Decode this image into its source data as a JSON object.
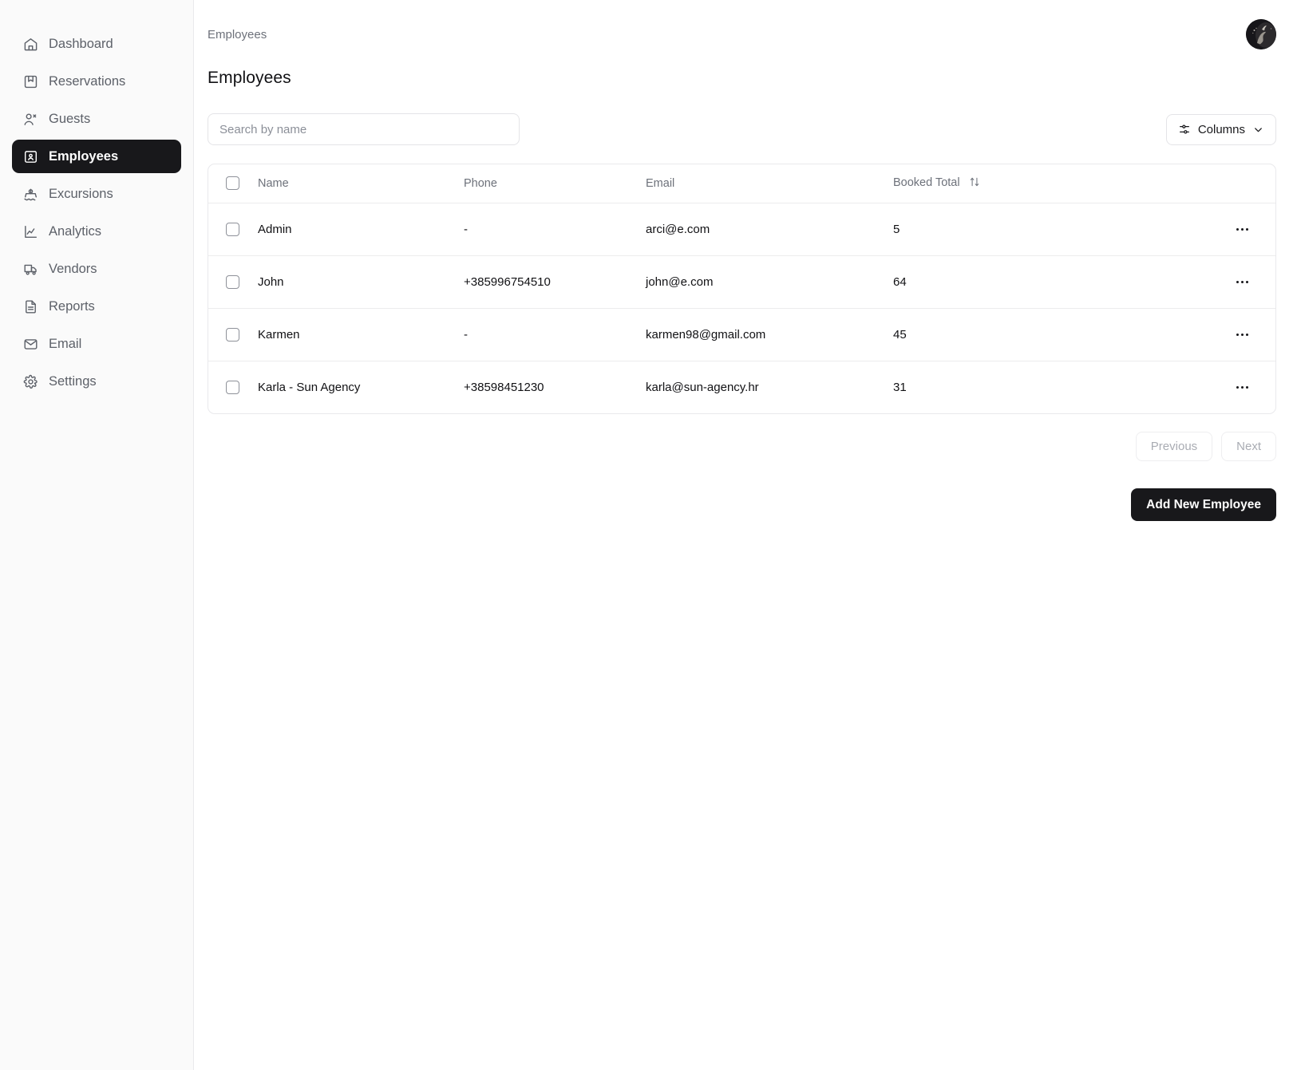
{
  "sidebar": {
    "items": [
      {
        "label": "Dashboard",
        "icon": "home-icon",
        "active": false
      },
      {
        "label": "Reservations",
        "icon": "bookmark-icon",
        "active": false
      },
      {
        "label": "Guests",
        "icon": "users-icon",
        "active": false
      },
      {
        "label": "Employees",
        "icon": "contact-icon",
        "active": true
      },
      {
        "label": "Excursions",
        "icon": "boat-icon",
        "active": false
      },
      {
        "label": "Analytics",
        "icon": "line-chart-icon",
        "active": false
      },
      {
        "label": "Vendors",
        "icon": "truck-icon",
        "active": false
      },
      {
        "label": "Reports",
        "icon": "document-icon",
        "active": false
      },
      {
        "label": "Email",
        "icon": "envelope-icon",
        "active": false
      },
      {
        "label": "Settings",
        "icon": "gear-icon",
        "active": false
      }
    ]
  },
  "topbar": {
    "breadcrumb": "Employees",
    "avatar_icon": "user-avatar"
  },
  "page": {
    "title": "Employees"
  },
  "toolbar": {
    "search_placeholder": "Search by name",
    "search_value": "",
    "columns_label": "Columns",
    "columns_icon": "sliders-icon",
    "chevron_icon": "chevron-down-icon"
  },
  "table": {
    "columns": [
      "Name",
      "Phone",
      "Email",
      "Booked Total"
    ],
    "sort_column": "Booked Total",
    "sort_icon": "sort-arrows-icon",
    "rows": [
      {
        "checked": false,
        "name": "Admin",
        "phone": "-",
        "email": "arci@e.com",
        "booked_total": "5"
      },
      {
        "checked": false,
        "name": "John",
        "phone": "+385996754510",
        "email": "john@e.com",
        "booked_total": "64"
      },
      {
        "checked": false,
        "name": "Karmen",
        "phone": "-",
        "email": "karmen98@gmail.com",
        "booked_total": "45"
      },
      {
        "checked": false,
        "name": "Karla - Sun Agency",
        "phone": "+38598451230",
        "email": "karla@sun-agency.hr",
        "booked_total": "31"
      }
    ]
  },
  "pagination": {
    "previous_label": "Previous",
    "next_label": "Next"
  },
  "actions": {
    "add_label": "Add New Employee"
  },
  "colors": {
    "accent": "#18181b",
    "sidebar_bg": "#fafafa",
    "border": "#e9e9ec",
    "muted_text": "#6d717a"
  }
}
